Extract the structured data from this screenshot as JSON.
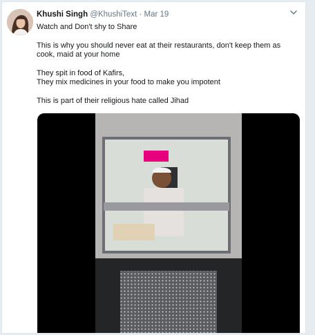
{
  "tweet": {
    "author_name": "Khushi Singh",
    "handle": "@KhushiText",
    "separator": "·",
    "date": "Mar 19",
    "lines": [
      "Watch and Don't shy to Share",
      "This is why you should never eat at their restaurants, don't keep them as cook, maid at your home",
      "They spit in food of Kafirs,",
      "They mix medicines in your food to make you impotent",
      "This is part of their religious hate called Jihad"
    ],
    "icons": {
      "menu": "chevron-down-icon",
      "avatar": "avatar",
      "media": "video-thumbnail"
    }
  },
  "colors": {
    "accent": "#1da1f2",
    "text": "#14171a",
    "muted": "#657786",
    "border": "#e1e8ed",
    "sign": "#e6007e"
  }
}
